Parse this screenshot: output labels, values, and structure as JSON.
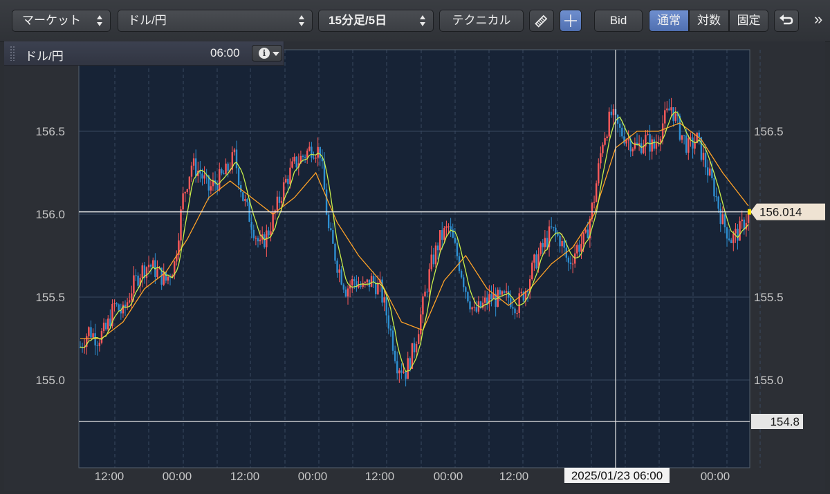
{
  "toolbar": {
    "market": "マーケット",
    "symbol": "ドル/円",
    "timeframe": "15分足/5日",
    "technical": "テクニカル",
    "pencil_icon": "pencil-icon",
    "crosshair_icon": "crosshair-icon",
    "bid": "Bid",
    "scale_normal": "通常",
    "scale_log": "対数",
    "scale_fixed": "固定",
    "undo_icon": "undo-icon",
    "more": "»"
  },
  "legend": {
    "symbol": "ドル/円",
    "time": "06:00",
    "info_icon": "info-icon"
  },
  "colors": {
    "background": "#172336",
    "grid": "#3a4a60",
    "candle_up": "#ff5a5a",
    "candle_down": "#2e8fd1",
    "ma_short": "#c8ef4a",
    "ma_long": "#ffa227",
    "price_line": "#e8e8e8"
  },
  "chart_data": {
    "type": "candlestick",
    "y_ticks": [
      "156.5",
      "156.0",
      "155.5",
      "155.0"
    ],
    "x_ticks": [
      "12:00",
      "00:00",
      "12:00",
      "00:00",
      "12:00",
      "00:00",
      "12:00",
      "00:00"
    ],
    "ylim": [
      154.6,
      156.8
    ],
    "price_label": "156.014",
    "current_price": 156.014,
    "low_line_label": "154.8",
    "low_line_value": 154.75,
    "crosshair_time_label": "2025/01/23 06:00",
    "close_path": [
      [
        0,
        155.2
      ],
      [
        4,
        155.3
      ],
      [
        8,
        155.25
      ],
      [
        12,
        155.3
      ],
      [
        16,
        155.45
      ],
      [
        20,
        155.4
      ],
      [
        24,
        155.55
      ],
      [
        28,
        155.65
      ],
      [
        32,
        155.7
      ],
      [
        36,
        155.65
      ],
      [
        40,
        155.6
      ],
      [
        44,
        155.7
      ],
      [
        48,
        156.1
      ],
      [
        52,
        156.3
      ],
      [
        56,
        156.25
      ],
      [
        60,
        156.15
      ],
      [
        64,
        156.2
      ],
      [
        68,
        156.25
      ],
      [
        72,
        156.35
      ],
      [
        76,
        156.1
      ],
      [
        80,
        155.95
      ],
      [
        84,
        155.8
      ],
      [
        88,
        155.9
      ],
      [
        92,
        156.05
      ],
      [
        96,
        156.2
      ],
      [
        100,
        156.3
      ],
      [
        104,
        156.35
      ],
      [
        108,
        156.4
      ],
      [
        112,
        156.38
      ],
      [
        116,
        155.9
      ],
      [
        120,
        155.7
      ],
      [
        124,
        155.55
      ],
      [
        128,
        155.6
      ],
      [
        132,
        155.55
      ],
      [
        136,
        155.6
      ],
      [
        140,
        155.55
      ],
      [
        144,
        155.35
      ],
      [
        148,
        155.1
      ],
      [
        152,
        155.05
      ],
      [
        156,
        155.2
      ],
      [
        160,
        155.45
      ],
      [
        164,
        155.7
      ],
      [
        168,
        155.85
      ],
      [
        172,
        155.92
      ],
      [
        176,
        155.75
      ],
      [
        180,
        155.55
      ],
      [
        184,
        155.4
      ],
      [
        188,
        155.45
      ],
      [
        192,
        155.5
      ],
      [
        196,
        155.48
      ],
      [
        200,
        155.5
      ],
      [
        204,
        155.45
      ],
      [
        208,
        155.55
      ],
      [
        212,
        155.7
      ],
      [
        216,
        155.8
      ],
      [
        220,
        155.9
      ],
      [
        224,
        155.85
      ],
      [
        228,
        155.7
      ],
      [
        232,
        155.8
      ],
      [
        236,
        155.85
      ],
      [
        240,
        156.1
      ],
      [
        244,
        156.45
      ],
      [
        248,
        156.6
      ],
      [
        252,
        156.5
      ],
      [
        256,
        156.45
      ],
      [
        260,
        156.4
      ],
      [
        264,
        156.45
      ],
      [
        268,
        156.4
      ],
      [
        272,
        156.55
      ],
      [
        276,
        156.65
      ],
      [
        280,
        156.5
      ],
      [
        284,
        156.4
      ],
      [
        288,
        156.45
      ],
      [
        292,
        156.3
      ],
      [
        296,
        156.15
      ],
      [
        300,
        155.95
      ],
      [
        304,
        155.85
      ],
      [
        308,
        155.9
      ],
      [
        312,
        156.0
      ]
    ],
    "ma_long_path": [
      [
        0,
        155.25
      ],
      [
        10,
        155.25
      ],
      [
        20,
        155.35
      ],
      [
        30,
        155.55
      ],
      [
        40,
        155.65
      ],
      [
        50,
        155.85
      ],
      [
        60,
        156.1
      ],
      [
        70,
        156.2
      ],
      [
        80,
        156.1
      ],
      [
        90,
        156.0
      ],
      [
        100,
        156.1
      ],
      [
        110,
        156.25
      ],
      [
        120,
        155.95
      ],
      [
        130,
        155.75
      ],
      [
        140,
        155.6
      ],
      [
        150,
        155.35
      ],
      [
        160,
        155.3
      ],
      [
        170,
        155.6
      ],
      [
        180,
        155.75
      ],
      [
        190,
        155.55
      ],
      [
        200,
        155.45
      ],
      [
        210,
        155.55
      ],
      [
        220,
        155.7
      ],
      [
        230,
        155.8
      ],
      [
        240,
        156.0
      ],
      [
        250,
        156.4
      ],
      [
        260,
        156.5
      ],
      [
        270,
        156.5
      ],
      [
        280,
        156.55
      ],
      [
        290,
        156.45
      ],
      [
        300,
        156.25
      ],
      [
        312,
        156.05
      ]
    ]
  }
}
